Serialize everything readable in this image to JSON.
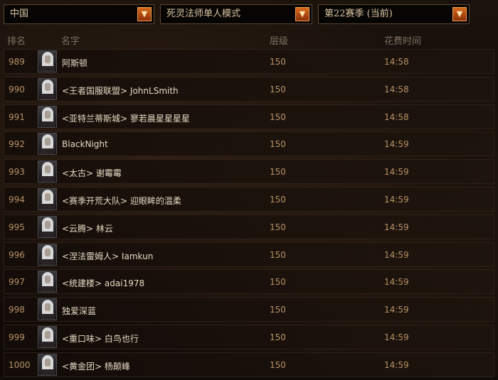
{
  "filters": {
    "region": "中国",
    "mode": "死灵法师单人模式",
    "season": "第22赛季 (当前)"
  },
  "header": {
    "rank": "排名",
    "name": "名字",
    "level": "层级",
    "time": "花费时间"
  },
  "rows": [
    {
      "rank": "989",
      "name": "阿斯顿",
      "level": "150",
      "time": "14:58"
    },
    {
      "rank": "990",
      "name": "<王者国服联盟> JohnLSmith",
      "level": "150",
      "time": "14:58"
    },
    {
      "rank": "991",
      "name": "<亚特兰蒂斯城> 寥若晨星星星星",
      "level": "150",
      "time": "14:58"
    },
    {
      "rank": "992",
      "name": "BlackNight",
      "level": "150",
      "time": "14:59"
    },
    {
      "rank": "993",
      "name": "<太古> 谢霉霉",
      "level": "150",
      "time": "14:59"
    },
    {
      "rank": "994",
      "name": "<赛季开荒大队> 迎眼眸的温柔",
      "level": "150",
      "time": "14:59"
    },
    {
      "rank": "995",
      "name": "<云腾> 林云",
      "level": "150",
      "time": "14:59"
    },
    {
      "rank": "996",
      "name": "<涅法雷姆人> Iamkun",
      "level": "150",
      "time": "14:59"
    },
    {
      "rank": "997",
      "name": "<统建楼> adai1978",
      "level": "150",
      "time": "14:59"
    },
    {
      "rank": "998",
      "name": "独爱深蓝",
      "level": "150",
      "time": "14:59"
    },
    {
      "rank": "999",
      "name": "<重口味> 白鸟也行",
      "level": "150",
      "time": "14:59"
    },
    {
      "rank": "1000",
      "name": "<黄金团> 杨颠峰",
      "level": "150",
      "time": "14:59"
    }
  ]
}
